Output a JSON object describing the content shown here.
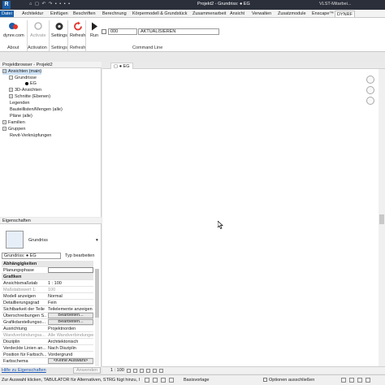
{
  "titlebar": {
    "title": "Projekt2 - Grundriss: ● EG",
    "search_text": "VLST-Mitarbei...",
    "logo": "R",
    "quick_access": "⌂ ▢ ↶ ↷ ▪ ▪ ▪ ▪"
  },
  "menu": {
    "tabs": [
      "Datei",
      "Architektur",
      "Einfügen",
      "Beschriften",
      "Berechnung",
      "Körpermodell & Grundstück",
      "Zusammenarbeit",
      "Ansicht",
      "Verwalten",
      "Zusatzmodule",
      "Enscape™",
      "DYNRF"
    ]
  },
  "ribbon": {
    "buttons": [
      {
        "label": "dynre.com",
        "icon": "dynre-logo-icon",
        "disabled": false
      },
      {
        "label": "Activate",
        "icon": "activate-icon",
        "disabled": true
      },
      {
        "label": "Settings",
        "icon": "gear-icon",
        "disabled": false
      },
      {
        "label": "Refresh",
        "icon": "refresh-icon",
        "disabled": false
      },
      {
        "label": "Run",
        "icon": "play-icon",
        "disabled": false
      }
    ],
    "panels": [
      "About",
      "Activation",
      "Settings",
      "Refresh",
      "Command Line"
    ],
    "command_count": "000",
    "command_input": "AKTUALISIEREN"
  },
  "project_browser": {
    "title": "Projektbrowser - Projekt2",
    "items": [
      {
        "label": "Ansichten (main)",
        "level": 0,
        "expanded": true,
        "selected": true
      },
      {
        "label": "Grundrisse",
        "level": 1,
        "expanded": true
      },
      {
        "label": "EG",
        "level": 2,
        "current": true
      },
      {
        "label": "3D-Ansichten",
        "level": 1,
        "expanded": false
      },
      {
        "label": "Schnitte (Ebenen)",
        "level": 1,
        "expanded": false
      },
      {
        "label": "Legenden",
        "level": 0
      },
      {
        "label": "Bauteillisten/Mengen (alle)",
        "level": 0
      },
      {
        "label": "Pläne (alle)",
        "level": 0
      },
      {
        "label": "Familien",
        "level": 0,
        "expanded": false
      },
      {
        "label": "Gruppen",
        "level": 0,
        "expanded": false
      },
      {
        "label": "Revit-Verknüpfungen",
        "level": 0
      }
    ]
  },
  "properties": {
    "title": "Eigenschaften",
    "type_name": "Grundriss",
    "filter": "Grundriss: ● EG",
    "edit_type": "Typ bearbeiten",
    "rows": [
      {
        "key": "Abhängigkeiten",
        "group": true
      },
      {
        "key": "Planungsphase",
        "value": "",
        "field": true
      },
      {
        "key": "Grafiken",
        "group": true
      },
      {
        "key": "Ansichtsmaßstab",
        "value": "1 : 100"
      },
      {
        "key": "Maßstabswert 1:",
        "value": "100",
        "grey": true
      },
      {
        "key": "Modell anzeigen",
        "value": "Normal"
      },
      {
        "key": "Detaillierungsgrad",
        "value": "Fein"
      },
      {
        "key": "Sichtbarkeit der Teile",
        "value": "Teilelemente anzeigen"
      },
      {
        "key": "Überschreibungen S...",
        "value": "Bearbeiten...",
        "button": true
      },
      {
        "key": "Grafikdarstellungso...",
        "value": "Bearbeiten...",
        "button": true
      },
      {
        "key": "Ausrichtung",
        "value": "Projektnorden"
      },
      {
        "key": "Wandverbindungsa...",
        "value": "Alle Wandverbindungen",
        "grey": true
      },
      {
        "key": "Disziplin",
        "value": "Architektonisch"
      },
      {
        "key": "Verdeckte Linien an...",
        "value": "Nach Disziplin"
      },
      {
        "key": "Position für Farbsch...",
        "value": "Vordergrund"
      },
      {
        "key": "Farbschema",
        "value": "<Keine Auswahl>",
        "button": true
      }
    ],
    "help_link": "Hilfe zu Eigenschaften",
    "apply_button": "Anwenden"
  },
  "view": {
    "tab_label": "EG",
    "scale": "1 : 100"
  },
  "statusbar": {
    "message": "Zur Auswahl klicken, TABULATOR für Alternativen, STRG fügt hinzu, UMSCHALT hebt Auswahl auf.",
    "model": "Basisvorlage",
    "only_selected": "Optionen ausschließen"
  }
}
